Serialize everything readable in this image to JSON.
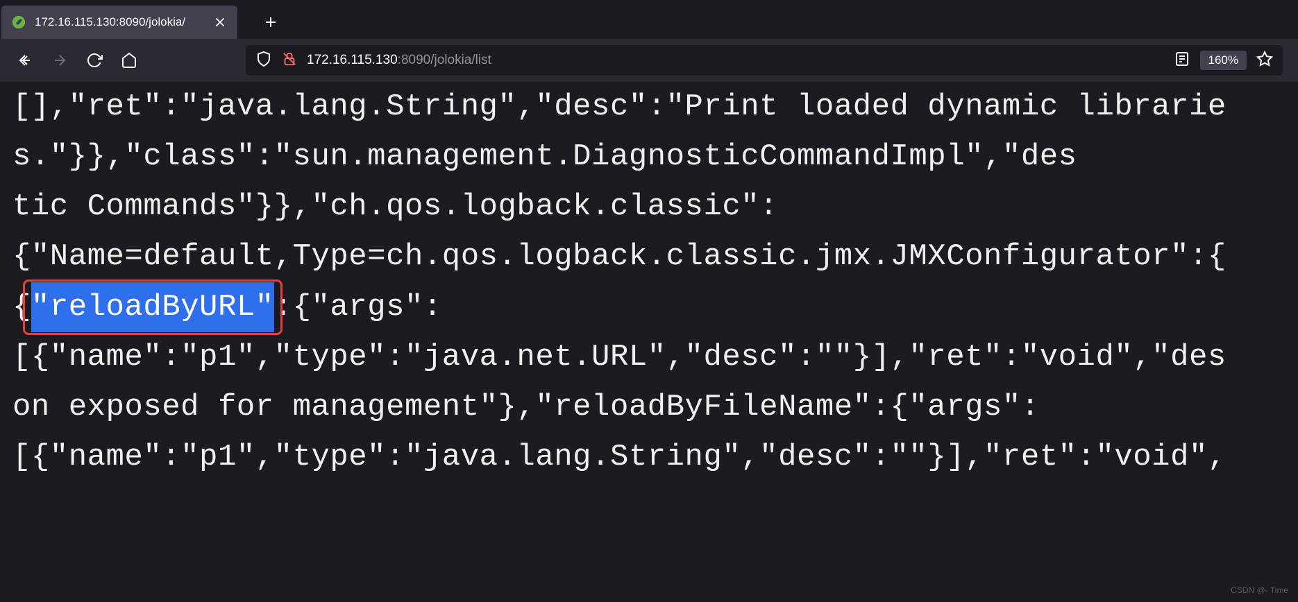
{
  "tab": {
    "title": "172.16.115.130:8090/jolokia/"
  },
  "url": {
    "host": "172.16.115.130",
    "port": ":8090",
    "path": "/jolokia/list"
  },
  "zoom": "160%",
  "content": {
    "line1": "[],\"ret\":\"java.lang.String\",\"desc\":\"Print loaded dynamic libraries.\"}},\"class\":\"sun.management.DiagnosticCommandImpl\",\"des",
    "line2_pre": "tic Commands\"}},\"ch.qos.logback.classic\":",
    "line3": "{\"Name=default,Type=ch.qos.logback.classic.jmx.JMXConfigurator\":{",
    "line4_pre": "{",
    "line4_highlight": "\"reloadByURL\"",
    "line4_post": ":{\"args\":",
    "line5": "[{\"name\":\"p1\",\"type\":\"java.net.URL\",\"desc\":\"\"}],\"ret\":\"void\",\"des",
    "line6": "on exposed for management\"},\"reloadByFileName\":{\"args\":",
    "line7": "[{\"name\":\"p1\",\"type\":\"java.lang.String\",\"desc\":\"\"}],\"ret\":\"void\","
  },
  "watermark": "CSDN @- Time"
}
